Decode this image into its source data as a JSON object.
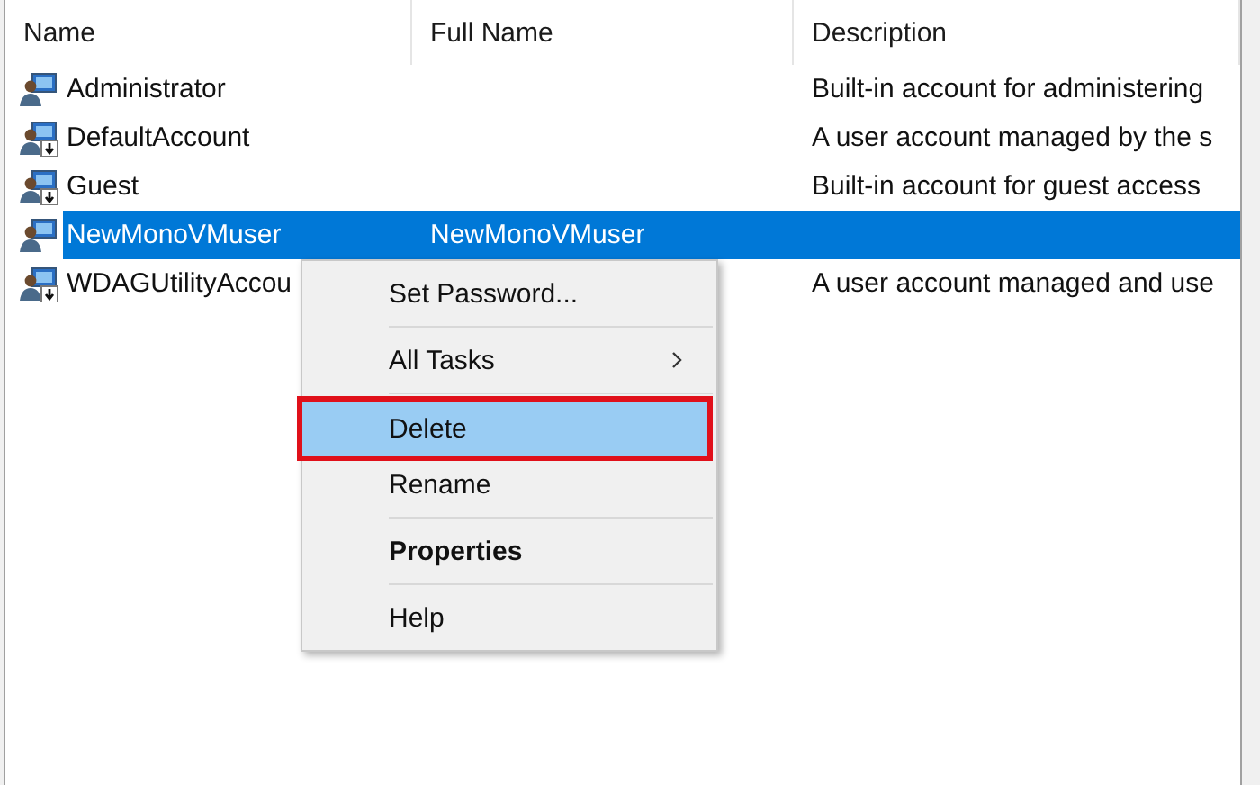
{
  "table": {
    "columns": [
      "Name",
      "Full Name",
      "Description"
    ],
    "rows": [
      {
        "name": "Administrator",
        "full_name": "",
        "description": "Built-in account for administering",
        "disabled": false,
        "selected": false
      },
      {
        "name": "DefaultAccount",
        "full_name": "",
        "description": "A user account managed by the s",
        "disabled": true,
        "selected": false
      },
      {
        "name": "Guest",
        "full_name": "",
        "description": "Built-in account for guest access",
        "disabled": true,
        "selected": false
      },
      {
        "name": "NewMonoVMuser",
        "full_name": "NewMonoVMuser",
        "description": "",
        "disabled": false,
        "selected": true
      },
      {
        "name": "WDAGUtilityAccou",
        "full_name": "",
        "description": "A user account managed and use",
        "disabled": true,
        "selected": false
      }
    ]
  },
  "context_menu": {
    "items": [
      {
        "kind": "item",
        "label": "Set Password...",
        "selected": false,
        "default": false,
        "has_submenu": false,
        "outlined": false
      },
      {
        "kind": "separator"
      },
      {
        "kind": "item",
        "label": "All Tasks",
        "selected": false,
        "default": false,
        "has_submenu": true,
        "outlined": false
      },
      {
        "kind": "separator"
      },
      {
        "kind": "item",
        "label": "Delete",
        "selected": true,
        "default": false,
        "has_submenu": false,
        "outlined": true
      },
      {
        "kind": "item",
        "label": "Rename",
        "selected": false,
        "default": false,
        "has_submenu": false,
        "outlined": false
      },
      {
        "kind": "separator"
      },
      {
        "kind": "item",
        "label": "Properties",
        "selected": false,
        "default": true,
        "has_submenu": false,
        "outlined": false
      },
      {
        "kind": "separator"
      },
      {
        "kind": "item",
        "label": "Help",
        "selected": false,
        "default": false,
        "has_submenu": false,
        "outlined": false
      }
    ]
  }
}
